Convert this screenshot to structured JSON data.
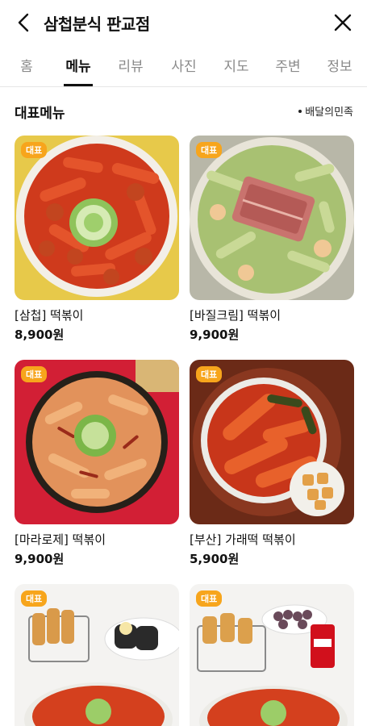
{
  "header": {
    "title": "삼첩분식 판교점",
    "back_icon": "chevron-left-icon",
    "close_icon": "close-icon"
  },
  "tabs": [
    {
      "label": "홈",
      "active": false
    },
    {
      "label": "메뉴",
      "active": true
    },
    {
      "label": "리뷰",
      "active": false
    },
    {
      "label": "사진",
      "active": false
    },
    {
      "label": "지도",
      "active": false
    },
    {
      "label": "주변",
      "active": false
    },
    {
      "label": "정보",
      "active": false
    }
  ],
  "section": {
    "title": "대표메뉴",
    "source": "배달의민족"
  },
  "menu": [
    {
      "badge": "대표",
      "name": "[삼첩] 떡볶이",
      "price": "8,900원"
    },
    {
      "badge": "대표",
      "name": "[바질크림] 떡볶이",
      "price": "9,900원"
    },
    {
      "badge": "대표",
      "name": "[마라로제] 떡볶이",
      "price": "9,900원"
    },
    {
      "badge": "대표",
      "name": "[부산] 가래떡 떡볶이",
      "price": "5,900원"
    },
    {
      "badge": "대표",
      "name": "",
      "price": ""
    },
    {
      "badge": "대표",
      "name": "",
      "price": ""
    }
  ],
  "colors": {
    "badge": "#f7a51c",
    "active_tab": "#111111",
    "inactive_tab": "#8a8a8a"
  }
}
